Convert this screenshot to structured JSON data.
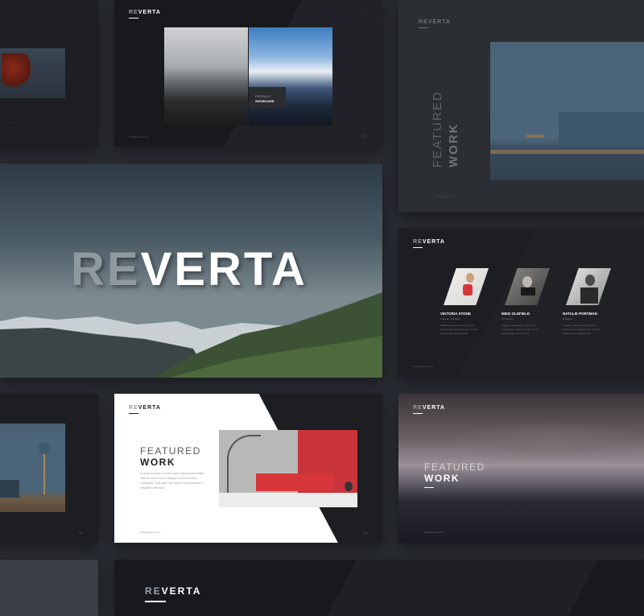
{
  "brand": {
    "prefix": "RE",
    "suffix": "VERTA"
  },
  "hero": {
    "prefix": "RE",
    "suffix": "VERTA"
  },
  "product_slide": {
    "label_top": "PRODUCT",
    "label_bottom": "SHOWCASE"
  },
  "featured_vertical": {
    "line1": "FEATURED",
    "line2": "WORK"
  },
  "team": {
    "members": [
      {
        "name": "VIKTORIA STONE",
        "role": "Founder, Manager",
        "bio": "Sagittis malesuada sit amet nisi. Consectetur adipiscing elit. Ut enim pellentesque suscipit velit."
      },
      {
        "name": "MIKE OLDFIELD",
        "role": "Art Director",
        "bio": "Sagittis malesuada sit amet nisi. Consectetur adipiscing elit. Ut enim pellentesque suscipit velit."
      },
      {
        "name": "NATALIE PORTMAN",
        "role": "Designer",
        "bio": "Sagittis malesuada sit amet nisi. Consectetur adipiscing elit. Ut enim pellentesque suscipit velit."
      }
    ]
  },
  "featured_white": {
    "line1": "FEATURED",
    "line2": "WORK",
    "body": "Ut enim ad minim veniam, quis nostrud exercitation ullamco laboris nisi ut aliquip ex ea commodo consequat. Duis aute irure dolor in reprehenderit in voluptate velit esse."
  },
  "featured_sea": {
    "line1": "FEATURED",
    "line2": "WORK"
  },
  "footer_email": "hello@reverta.com",
  "colors": {
    "accent_red": "#d6363a",
    "logo_grey": "#9aa0a8"
  }
}
